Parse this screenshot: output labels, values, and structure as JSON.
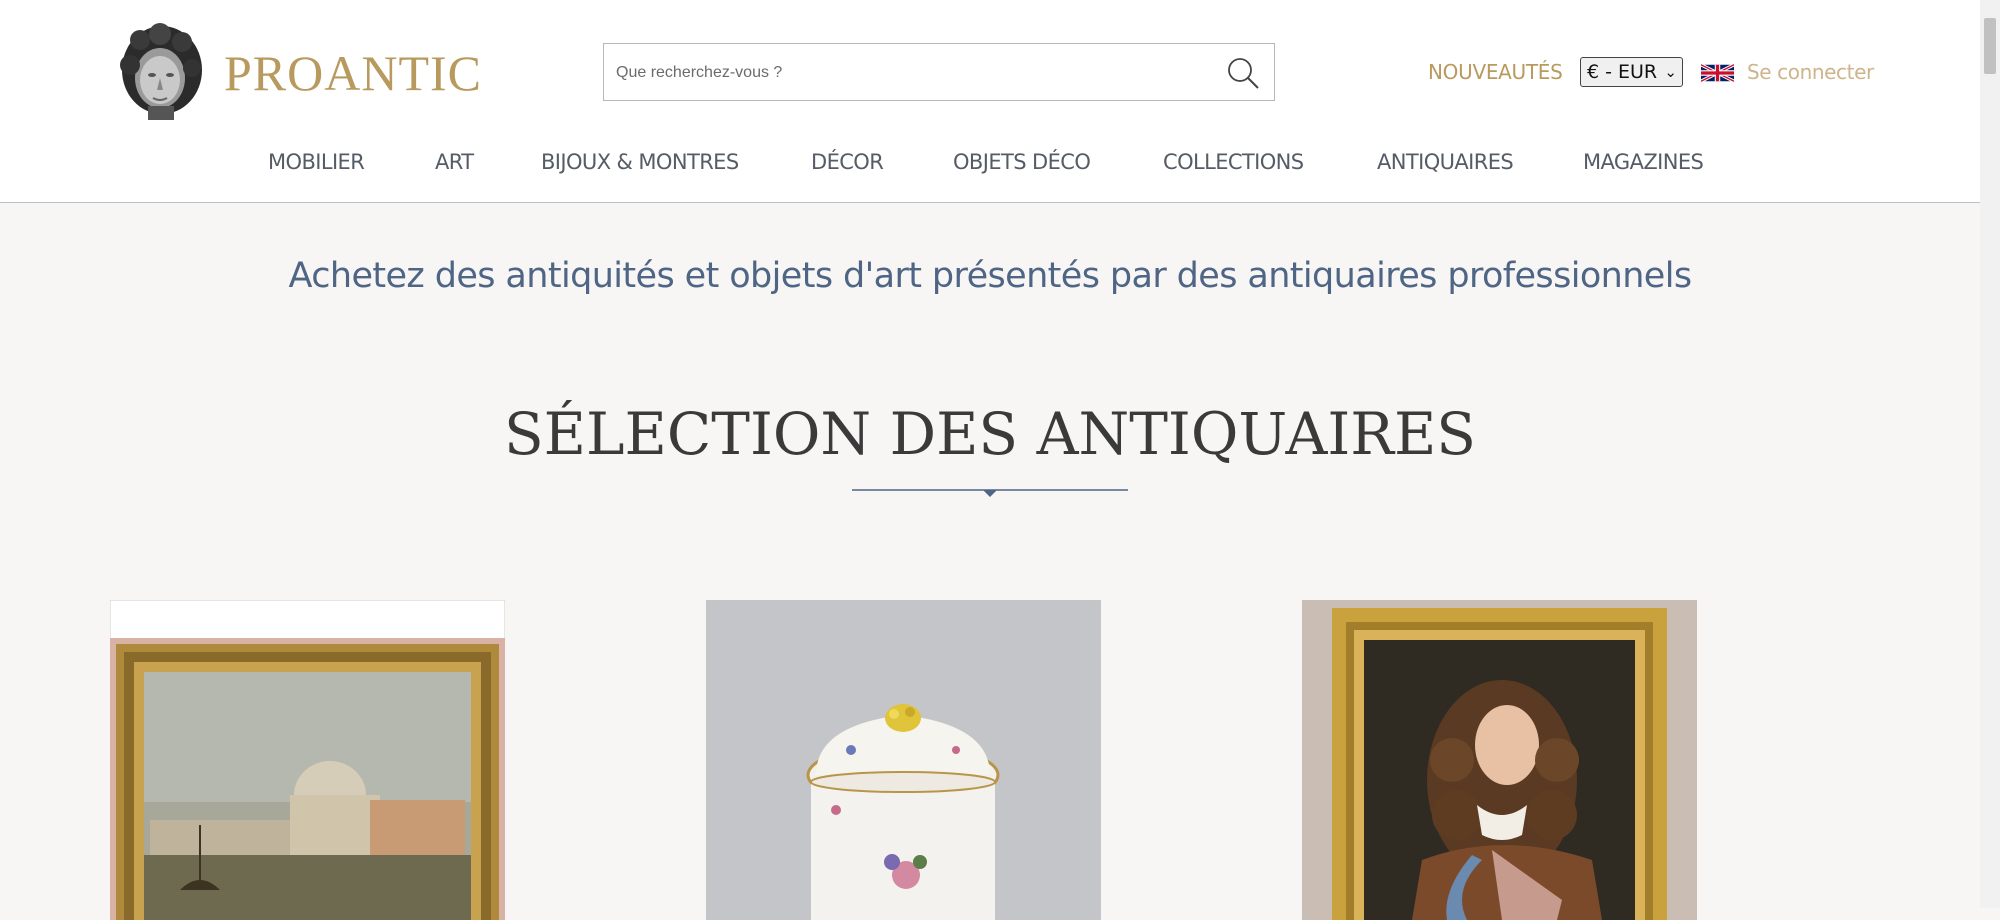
{
  "header": {
    "logo_text": "PROANTIC",
    "search": {
      "placeholder": "Que recherchez-vous ?"
    },
    "nouveautes": "NOUVEAUTÉS",
    "currency": "€ - EUR",
    "login": "Se connecter"
  },
  "nav": [
    "MOBILIER",
    "ART",
    "BIJOUX & MONTRES",
    "DÉCOR",
    "OBJETS DÉCO",
    "COLLECTIONS",
    "ANTIQUAIRES",
    "MAGAZINES"
  ],
  "tagline": "Achetez des antiquités et objets d'art présentés par des antiquaires professionnels",
  "section_title": "SÉLECTION DES ANTIQUAIRES",
  "colors": {
    "gold": "#b89a5e",
    "tagline_blue": "#4f6585",
    "background": "#f7f6f4"
  },
  "cards": [
    {
      "icon": "venice-painting-image"
    },
    {
      "icon": "porcelain-pot-image"
    },
    {
      "icon": "portrait-painting-image"
    }
  ]
}
